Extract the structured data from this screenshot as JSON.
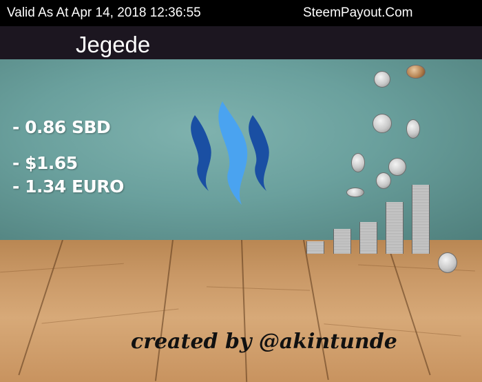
{
  "header": {
    "valid_text": "Valid As At Apr 14, 2018 12:36:55",
    "site": "SteemPayout.Com"
  },
  "user": {
    "name": "Jegede"
  },
  "payout": {
    "sbd": "- 0.86 SBD",
    "usd": "- $1.65",
    "euro": "- 1.34 EURO"
  },
  "credit": "created by @akintunde",
  "colors": {
    "steem_dark": "#1a4fa3",
    "steem_light": "#4aa3f0"
  }
}
